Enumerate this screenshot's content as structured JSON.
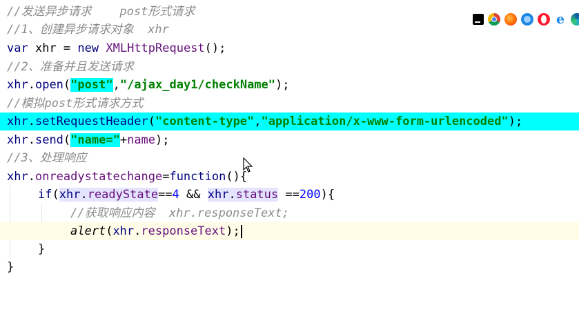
{
  "editor": {
    "comment1": "//发送异步请求    post形式请求",
    "comment2": "//1、创建异步请求对象  xhr",
    "l3": {
      "kw": "var",
      "var": "xhr",
      "eq": " = ",
      "new": "new",
      "ctor": "XMLHttpRequest",
      "end": "();"
    },
    "comment4": "//2、准备并且发送请求",
    "l5": {
      "obj": "xhr",
      "dot": ".",
      "method": "open",
      "open": "(",
      "arg1": "\"post\"",
      "comma": ",",
      "arg2": "\"/ajax_day1/checkName\"",
      "end": ");"
    },
    "comment6": "//模拟post形式请求方式",
    "l7": {
      "obj": "xhr",
      "dot": ".",
      "method": "setRequestHeader",
      "open": "(",
      "arg1": "\"content-type\"",
      "comma": ",",
      "arg2": "\"application/x-www-form-urlencoded\"",
      "end": ");"
    },
    "l8": {
      "obj": "xhr",
      "dot": ".",
      "method": "send",
      "open": "(",
      "arg1": "\"name=\"",
      "plus": "+",
      "arg2": "name",
      "end": ");"
    },
    "comment9": "//3、处理响应",
    "l10": {
      "obj": "xhr",
      "dot": ".",
      "prop": "onreadystatechange",
      "eq": "=",
      "kw": "function",
      "end": "(){"
    },
    "l11": {
      "kw": "if",
      "open": "(",
      "obj1": "xhr",
      "dot1": ".",
      "prop1": "readyState",
      "op1": "==",
      "num1": "4",
      "and": " && ",
      "obj2": "xhr",
      "dot2": ".",
      "prop2": "status",
      "op2": " ==",
      "num2": "200",
      "end": "){"
    },
    "comment12": "//获取响应内容  xhr.responseText;",
    "l13": {
      "fn": "alert",
      "open": "(",
      "obj": "xhr",
      "dot": ".",
      "prop": "responseText",
      "end": ");"
    },
    "l14": "}",
    "l15": "}"
  },
  "browser_icons": [
    "intellij-icon",
    "chrome-icon",
    "firefox-icon",
    "safari-icon",
    "opera-icon",
    "ie-icon",
    "edge-icon"
  ],
  "ie_glyph": "e",
  "colors": {
    "highlight": "#00ffff",
    "comment": "#8c8c8c",
    "string": "#008000",
    "number": "#0000ff",
    "keyword": "#000080",
    "property": "#660e7a"
  }
}
